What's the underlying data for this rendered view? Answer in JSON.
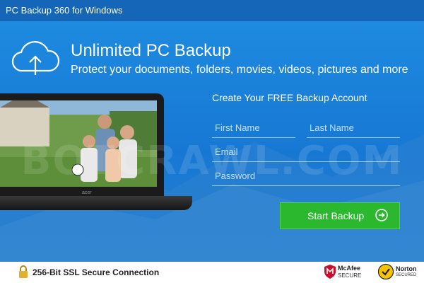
{
  "window": {
    "title": "PC Backup 360 for Windows"
  },
  "hero": {
    "icon": "cloud-upload-icon",
    "title": "Unlimited PC Backup",
    "subtitle": "Protect your documents, folders, movies, videos, pictures and more"
  },
  "laptop": {
    "brand": "acer"
  },
  "form": {
    "title": "Create Your FREE Backup Account",
    "first_name_placeholder": "First Name",
    "last_name_placeholder": "Last Name",
    "email_placeholder": "Email",
    "password_placeholder": "Password",
    "submit_label": "Start Backup",
    "submit_icon": "arrow-right-circle-icon"
  },
  "watermark": "BOTCRAWL.COM",
  "footer": {
    "ssl_text": "256-Bit SSL Secure Connection",
    "mcafee_name": "McAfee",
    "mcafee_sub": "SECURE",
    "norton_name": "Norton",
    "norton_sub": "SECURED"
  },
  "colors": {
    "titlebar": "#1565b8",
    "background": "#1778d4",
    "button": "#2bb82e",
    "footer": "#ffffff"
  }
}
